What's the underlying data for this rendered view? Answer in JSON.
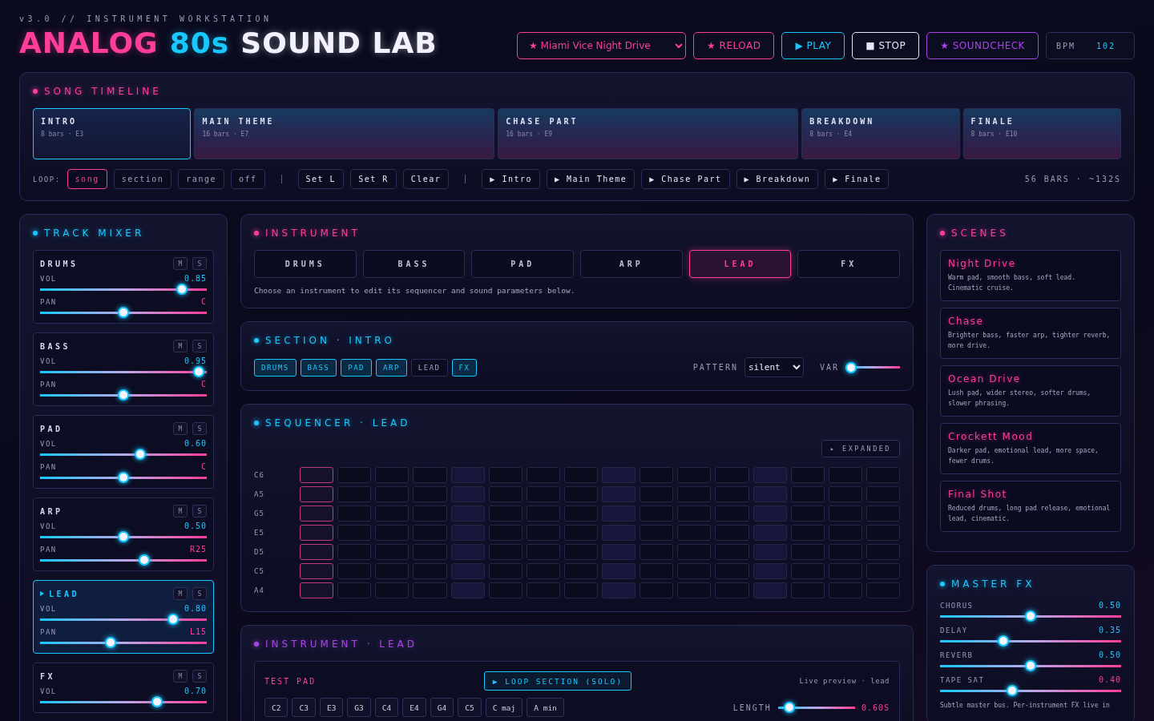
{
  "header": {
    "subtitle": "v3.0 // INSTRUMENT WORKSTATION",
    "title": [
      {
        "text": "ANALOG",
        "color": "#ff3d9a"
      },
      {
        "text": "80s",
        "color": "#19c8ff"
      },
      {
        "text": "SOUND LAB",
        "color": "#f2f2ff"
      }
    ],
    "preset": {
      "value": "★ Miami Vice Night Drive"
    },
    "buttons": [
      {
        "label": "★ RELOAD",
        "color": "#ff3d9a"
      },
      {
        "label": "▶ PLAY",
        "color": "#19c8ff"
      },
      {
        "label": "■ STOP",
        "color": "#e6e6f5"
      },
      {
        "label": "★ SOUNDCHECK",
        "color": "#a845e8"
      }
    ],
    "bpm": {
      "label": "BPM",
      "value": "102"
    }
  },
  "timeline": {
    "title": "SONG TIMELINE",
    "segments": [
      {
        "name": "INTRO",
        "meta": "8 bars · E3",
        "selected": true
      },
      {
        "name": "MAIN THEME",
        "meta": "16 bars · E7",
        "selected": false
      },
      {
        "name": "CHASE PART",
        "meta": "16 bars · E9",
        "selected": false
      },
      {
        "name": "BREAKDOWN",
        "meta": "8 bars · E4",
        "selected": false
      },
      {
        "name": "FINALE",
        "meta": "8 bars · E10",
        "selected": false
      }
    ],
    "loop_label": "LOOP:",
    "loop_options": [
      {
        "label": "song",
        "selected": true
      },
      {
        "label": "section",
        "selected": false
      },
      {
        "label": "range",
        "selected": false
      },
      {
        "label": "off",
        "selected": false
      }
    ],
    "range_buttons": [
      "Set L",
      "Set R",
      "Clear"
    ],
    "jump_buttons": [
      "▶ Intro",
      "▶ Main Theme",
      "▶ Chase Part",
      "▶ Breakdown",
      "▶ Finale"
    ],
    "summary": "56 BARS · ~132S"
  },
  "mixer": {
    "title": "TRACK MIXER",
    "tracks": [
      {
        "name": "DRUMS",
        "selected": false,
        "mute": "M",
        "solo": "S",
        "vol": {
          "label": "VOL",
          "value": "0.85",
          "level": 0.85
        },
        "pan": {
          "label": "PAN",
          "value": "C",
          "level": 0.5
        }
      },
      {
        "name": "BASS",
        "selected": false,
        "mute": "M",
        "solo": "S",
        "vol": {
          "label": "VOL",
          "value": "0.95",
          "level": 0.95
        },
        "pan": {
          "label": "PAN",
          "value": "C",
          "level": 0.5
        }
      },
      {
        "name": "PAD",
        "selected": false,
        "mute": "M",
        "solo": "S",
        "vol": {
          "label": "VOL",
          "value": "0.60",
          "level": 0.6
        },
        "pan": {
          "label": "PAN",
          "value": "C",
          "level": 0.5
        }
      },
      {
        "name": "ARP",
        "selected": false,
        "mute": "M",
        "solo": "S",
        "vol": {
          "label": "VOL",
          "value": "0.50",
          "level": 0.5
        },
        "pan": {
          "label": "PAN",
          "value": "R25",
          "level": 0.625
        }
      },
      {
        "name": "LEAD",
        "selected": true,
        "mute": "M",
        "solo": "S",
        "vol": {
          "label": "VOL",
          "value": "0.80",
          "level": 0.8
        },
        "pan": {
          "label": "PAN",
          "value": "L15",
          "level": 0.425
        }
      },
      {
        "name": "FX",
        "selected": false,
        "mute": "M",
        "solo": "S",
        "vol": {
          "label": "VOL",
          "value": "0.70",
          "level": 0.7
        }
      }
    ]
  },
  "instrument": {
    "title": "INSTRUMENT",
    "tabs": [
      {
        "label": "DRUMS",
        "selected": false
      },
      {
        "label": "BASS",
        "selected": false
      },
      {
        "label": "PAD",
        "selected": false
      },
      {
        "label": "ARP",
        "selected": false
      },
      {
        "label": "LEAD",
        "selected": true
      },
      {
        "label": "FX",
        "selected": false
      }
    ],
    "hint": "Choose an instrument to edit its sequencer and sound parameters below."
  },
  "section": {
    "title": "SECTION · INTRO",
    "chips": [
      {
        "label": "DRUMS",
        "on": true
      },
      {
        "label": "BASS",
        "on": true
      },
      {
        "label": "PAD",
        "on": true
      },
      {
        "label": "ARP",
        "on": true
      },
      {
        "label": "LEAD",
        "on": false
      },
      {
        "label": "FX",
        "on": true
      }
    ],
    "pattern_label": "PATTERN",
    "pattern": "silent",
    "var": {
      "label": "VAR",
      "level": 0.1
    }
  },
  "sequencer": {
    "title": "SEQUENCER · LEAD",
    "view_button": "▸ EXPANDED",
    "notes": [
      "C6",
      "A5",
      "G5",
      "E5",
      "D5",
      "C5",
      "A4"
    ],
    "steps": [
      {
        "playing": true,
        "downbeat": false
      },
      {
        "playing": false,
        "downbeat": false
      },
      {
        "playing": false,
        "downbeat": false
      },
      {
        "playing": false,
        "downbeat": false
      },
      {
        "playing": false,
        "downbeat": true
      },
      {
        "playing": false,
        "downbeat": false
      },
      {
        "playing": false,
        "downbeat": false
      },
      {
        "playing": false,
        "downbeat": false
      },
      {
        "playing": false,
        "downbeat": true
      },
      {
        "playing": false,
        "downbeat": false
      },
      {
        "playing": false,
        "downbeat": false
      },
      {
        "playing": false,
        "downbeat": false
      },
      {
        "playing": false,
        "downbeat": true
      },
      {
        "playing": false,
        "downbeat": false
      },
      {
        "playing": false,
        "downbeat": false
      },
      {
        "playing": false,
        "downbeat": false
      }
    ]
  },
  "instrument_detail": {
    "title": "INSTRUMENT · LEAD",
    "test_label": "TEST PAD",
    "loop_button": "▶ LOOP SECTION (SOLO)",
    "preview": "Live preview · lead",
    "keys": [
      "C2",
      "C3",
      "E3",
      "G3",
      "C4",
      "E4",
      "G4",
      "C5",
      "C maj",
      "A min"
    ],
    "length": {
      "label": "LENGTH",
      "level": 0.15,
      "value": "0.60S"
    }
  },
  "scenes": {
    "title": "SCENES",
    "items": [
      {
        "name": "Night Drive",
        "desc": "Warm pad, smooth bass, soft lead. Cinematic cruise."
      },
      {
        "name": "Chase",
        "desc": "Brighter bass, faster arp, tighter reverb, more drive."
      },
      {
        "name": "Ocean Drive",
        "desc": "Lush pad, wider stereo, softer drums, slower phrasing."
      },
      {
        "name": "Crockett Mood",
        "desc": "Darker pad, emotional lead, more space, fewer drums."
      },
      {
        "name": "Final Shot",
        "desc": "Reduced drums, long pad release, emotional lead, cinematic."
      }
    ]
  },
  "master_fx": {
    "title": "MASTER FX",
    "params": [
      {
        "name": "CHORUS",
        "value": "0.50",
        "level": 0.5,
        "color": "#19c8ff"
      },
      {
        "name": "DELAY",
        "value": "0.35",
        "level": 0.35,
        "color": "#19c8ff"
      },
      {
        "name": "REVERB",
        "value": "0.50",
        "level": 0.5,
        "color": "#19c8ff"
      },
      {
        "name": "TAPE SAT",
        "value": "0.40",
        "level": 0.4,
        "color": "#ff3d9a"
      }
    ],
    "note": "Subtle master bus. Per-instrument FX live in"
  }
}
